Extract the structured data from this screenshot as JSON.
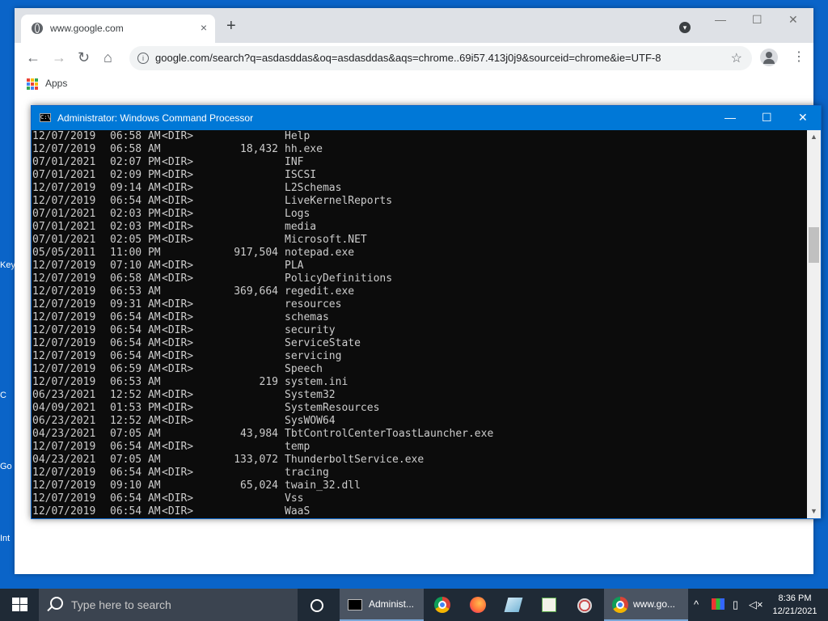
{
  "desktop": {
    "labels": [
      "Key",
      "C",
      "Go",
      "Int"
    ]
  },
  "chrome": {
    "tab_title": "www.google.com",
    "tab_close": "×",
    "new_tab": "+",
    "win_minimize": "—",
    "win_maximize": "☐",
    "win_close": "✕",
    "url": "google.com/search?q=asdasddas&oq=asdasddas&aqs=chrome..69i57.413j0j9&sourceid=chrome&ie=UTF-8",
    "bookmarks": {
      "apps_label": "Apps"
    },
    "apps_colors": [
      "#ea4335",
      "#fbbc05",
      "#34a853",
      "#4285f4",
      "#ea4335",
      "#fbbc05",
      "#34a853",
      "#4285f4",
      "#ea4335"
    ]
  },
  "cmd": {
    "title": "Administrator: Windows Command Processor",
    "minimize": "—",
    "maximize": "☐",
    "close": "✕",
    "rows": [
      {
        "date": "12/07/2019",
        "time": "06:58 AM",
        "dir": "<DIR>",
        "size": "",
        "name": "Help"
      },
      {
        "date": "12/07/2019",
        "time": "06:58 AM",
        "dir": "",
        "size": "18,432",
        "name": "hh.exe"
      },
      {
        "date": "07/01/2021",
        "time": "02:07 PM",
        "dir": "<DIR>",
        "size": "",
        "name": "INF"
      },
      {
        "date": "07/01/2021",
        "time": "02:09 PM",
        "dir": "<DIR>",
        "size": "",
        "name": "ISCSI"
      },
      {
        "date": "12/07/2019",
        "time": "09:14 AM",
        "dir": "<DIR>",
        "size": "",
        "name": "L2Schemas"
      },
      {
        "date": "12/07/2019",
        "time": "06:54 AM",
        "dir": "<DIR>",
        "size": "",
        "name": "LiveKernelReports"
      },
      {
        "date": "07/01/2021",
        "time": "02:03 PM",
        "dir": "<DIR>",
        "size": "",
        "name": "Logs"
      },
      {
        "date": "07/01/2021",
        "time": "02:03 PM",
        "dir": "<DIR>",
        "size": "",
        "name": "media"
      },
      {
        "date": "07/01/2021",
        "time": "02:05 PM",
        "dir": "<DIR>",
        "size": "",
        "name": "Microsoft.NET"
      },
      {
        "date": "05/05/2011",
        "time": "11:00 PM",
        "dir": "",
        "size": "917,504",
        "name": "notepad.exe"
      },
      {
        "date": "12/07/2019",
        "time": "07:10 AM",
        "dir": "<DIR>",
        "size": "",
        "name": "PLA"
      },
      {
        "date": "12/07/2019",
        "time": "06:58 AM",
        "dir": "<DIR>",
        "size": "",
        "name": "PolicyDefinitions"
      },
      {
        "date": "12/07/2019",
        "time": "06:53 AM",
        "dir": "",
        "size": "369,664",
        "name": "regedit.exe"
      },
      {
        "date": "12/07/2019",
        "time": "09:31 AM",
        "dir": "<DIR>",
        "size": "",
        "name": "resources"
      },
      {
        "date": "12/07/2019",
        "time": "06:54 AM",
        "dir": "<DIR>",
        "size": "",
        "name": "schemas"
      },
      {
        "date": "12/07/2019",
        "time": "06:54 AM",
        "dir": "<DIR>",
        "size": "",
        "name": "security"
      },
      {
        "date": "12/07/2019",
        "time": "06:54 AM",
        "dir": "<DIR>",
        "size": "",
        "name": "ServiceState"
      },
      {
        "date": "12/07/2019",
        "time": "06:54 AM",
        "dir": "<DIR>",
        "size": "",
        "name": "servicing"
      },
      {
        "date": "12/07/2019",
        "time": "06:59 AM",
        "dir": "<DIR>",
        "size": "",
        "name": "Speech"
      },
      {
        "date": "12/07/2019",
        "time": "06:53 AM",
        "dir": "",
        "size": "219",
        "name": "system.ini"
      },
      {
        "date": "06/23/2021",
        "time": "12:52 AM",
        "dir": "<DIR>",
        "size": "",
        "name": "System32"
      },
      {
        "date": "04/09/2021",
        "time": "01:53 PM",
        "dir": "<DIR>",
        "size": "",
        "name": "SystemResources"
      },
      {
        "date": "06/23/2021",
        "time": "12:52 AM",
        "dir": "<DIR>",
        "size": "",
        "name": "SysWOW64"
      },
      {
        "date": "04/23/2021",
        "time": "07:05 AM",
        "dir": "",
        "size": "43,984",
        "name": "TbtControlCenterToastLauncher.exe"
      },
      {
        "date": "12/07/2019",
        "time": "06:54 AM",
        "dir": "<DIR>",
        "size": "",
        "name": "temp"
      },
      {
        "date": "04/23/2021",
        "time": "07:05 AM",
        "dir": "",
        "size": "133,072",
        "name": "ThunderboltService.exe"
      },
      {
        "date": "12/07/2019",
        "time": "06:54 AM",
        "dir": "<DIR>",
        "size": "",
        "name": "tracing"
      },
      {
        "date": "12/07/2019",
        "time": "09:10 AM",
        "dir": "",
        "size": "65,024",
        "name": "twain_32.dll"
      },
      {
        "date": "12/07/2019",
        "time": "06:54 AM",
        "dir": "<DIR>",
        "size": "",
        "name": "Vss"
      },
      {
        "date": "12/07/2019",
        "time": "06:54 AM",
        "dir": "<DIR>",
        "size": "",
        "name": "WaaS"
      }
    ]
  },
  "taskbar": {
    "search_placeholder": "Type here to search",
    "cmd_label": "Administ...",
    "chrome_label": "www.go...",
    "time": "8:36 PM",
    "date": "12/21/2021"
  }
}
